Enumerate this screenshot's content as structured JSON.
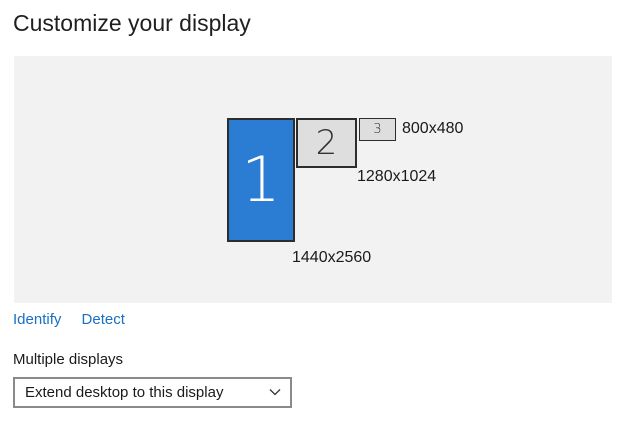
{
  "page": {
    "title": "Customize your display"
  },
  "displays": [
    {
      "number": "1",
      "resolution": "1440x2560",
      "selected": true
    },
    {
      "number": "2",
      "resolution": "1280x1024",
      "selected": false
    },
    {
      "number": "3",
      "resolution": "800x480",
      "selected": false
    }
  ],
  "actions": {
    "identify_label": "Identify",
    "detect_label": "Detect"
  },
  "multiple_displays": {
    "label": "Multiple displays",
    "selected_option": "Extend desktop to this display"
  },
  "colors": {
    "selected_display": "#2b7cd3",
    "unselected_display": "#dedede",
    "link": "#1a6fc6",
    "canvas": "#f2f2f2"
  },
  "icons": {
    "dropdown": "chevron-down-icon"
  }
}
